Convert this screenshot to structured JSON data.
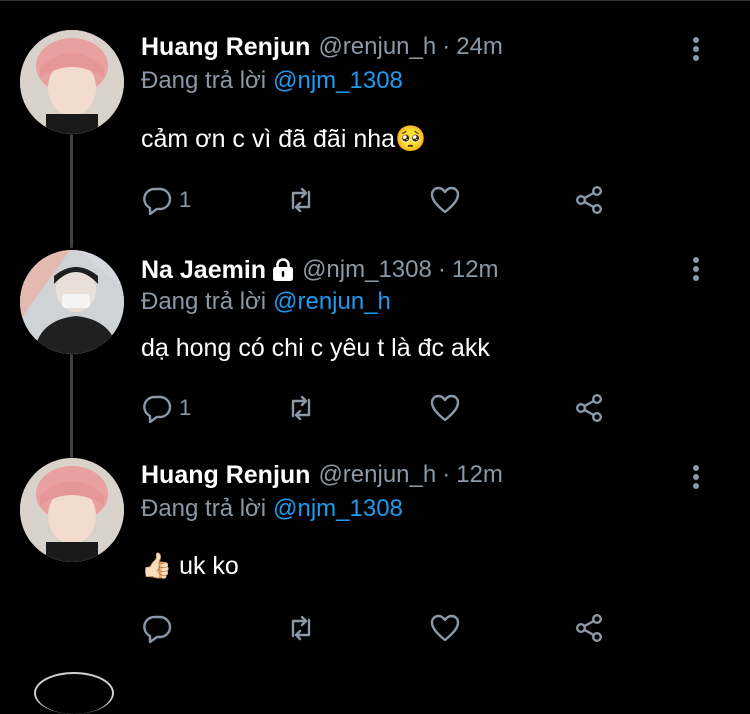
{
  "reply_prefix": "Đang trả lời",
  "tweets": [
    {
      "name": "Huang Renjun",
      "locked": false,
      "handle": "@renjun_h",
      "separator": "·",
      "time": "24m",
      "reply_to": "@njm_1308",
      "text": "cảm ơn c vì đã đãi nha🥺",
      "reply_count": "1"
    },
    {
      "name": "Na Jaemin",
      "locked": true,
      "handle": "@njm_1308",
      "separator": "·",
      "time": "12m",
      "reply_to": "@renjun_h",
      "text": "dạ hong có chi c yêu t là đc akk",
      "reply_count": "1"
    },
    {
      "name": "Huang Renjun",
      "locked": false,
      "handle": "@renjun_h",
      "separator": "·",
      "time": "12m",
      "reply_to": "@njm_1308",
      "text": "👍🏻  uk ko",
      "reply_count": ""
    }
  ],
  "colors": {
    "background": "#000000",
    "secondary_text": "#8b98a5",
    "mention": "#1d9bf0",
    "thread_line": "#3d4144"
  },
  "icons": [
    "reply-icon",
    "retweet-icon",
    "like-icon",
    "share-icon",
    "more-icon",
    "lock-icon"
  ]
}
